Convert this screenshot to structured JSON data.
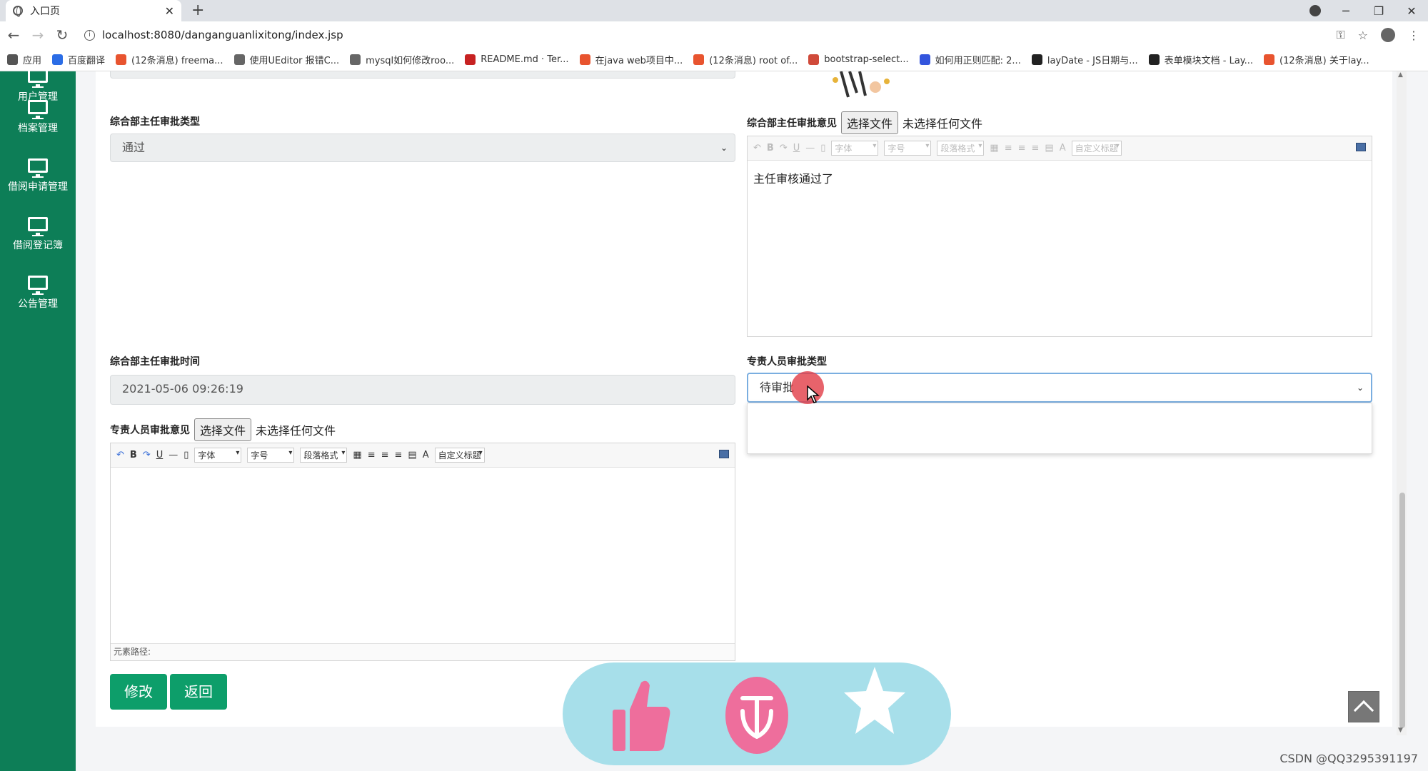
{
  "browser": {
    "tab_title": "入口页",
    "tab_close": "✕",
    "new_tab": "+",
    "url": "localhost:8080/danganguanlixitong/index.jsp",
    "window": {
      "minimize": "─",
      "restore": "❐",
      "close": "✕"
    }
  },
  "bookmarks": [
    {
      "label": "应用",
      "color": "#555555"
    },
    {
      "label": "百度翻译",
      "color": "#2b6de6"
    },
    {
      "label": "(12条消息) freema...",
      "color": "#e8542f"
    },
    {
      "label": "使用UEditor 报错C...",
      "color": "#666666"
    },
    {
      "label": "mysql如何修改roo...",
      "color": "#666666"
    },
    {
      "label": "README.md · Ter...",
      "color": "#c72222"
    },
    {
      "label": "在java web项目中...",
      "color": "#e8542f"
    },
    {
      "label": "(12条消息) root of...",
      "color": "#e8542f"
    },
    {
      "label": "bootstrap-select...",
      "color": "#d04a3a"
    },
    {
      "label": "如何用正则匹配: 2...",
      "color": "#3355dd"
    },
    {
      "label": "layDate - JS日期与...",
      "color": "#222222"
    },
    {
      "label": "表单模块文档 - Lay...",
      "color": "#222222"
    },
    {
      "label": "(12条消息) 关于lay...",
      "color": "#e8542f"
    }
  ],
  "sidebar": {
    "items": [
      {
        "label": "用户管理"
      },
      {
        "label": "档案管理"
      },
      {
        "label": "借阅申请管理"
      },
      {
        "label": "借阅登记簿"
      },
      {
        "label": "公告管理"
      }
    ]
  },
  "form": {
    "director_approval_type": {
      "label": "综合部主任审批类型",
      "value": "通过"
    },
    "director_opinion": {
      "label": "综合部主任审批意见",
      "file_button": "选择文件",
      "file_text": "未选择任何文件",
      "content": "主任审核通过了"
    },
    "director_approval_time": {
      "label": "综合部主任审批时间",
      "value": "2021-05-06 09:26:19"
    },
    "staff_approval_type": {
      "label": "专责人员审批类型",
      "value": "待审批"
    },
    "staff_opinion": {
      "label": "专责人员审批意见",
      "file_button": "选择文件",
      "file_text": "未选择任何文件",
      "content": "",
      "path_label": "元素路径:"
    }
  },
  "editor_toolbar": {
    "bold": "B",
    "underline": "U",
    "hr": "—",
    "font": "字体",
    "size": "字号",
    "paragraph": "段落格式",
    "color": "A",
    "custom_title": "自定义标题"
  },
  "buttons": {
    "modify": "修改",
    "back": "返回"
  },
  "watermark": "CSDN @QQ3295391197",
  "colors": {
    "sidebar": "#0d7e57",
    "button": "#0d9e6a",
    "focus_border": "#7aaee0",
    "pill": "#a7dfea",
    "pink": "#ee6e9c"
  }
}
